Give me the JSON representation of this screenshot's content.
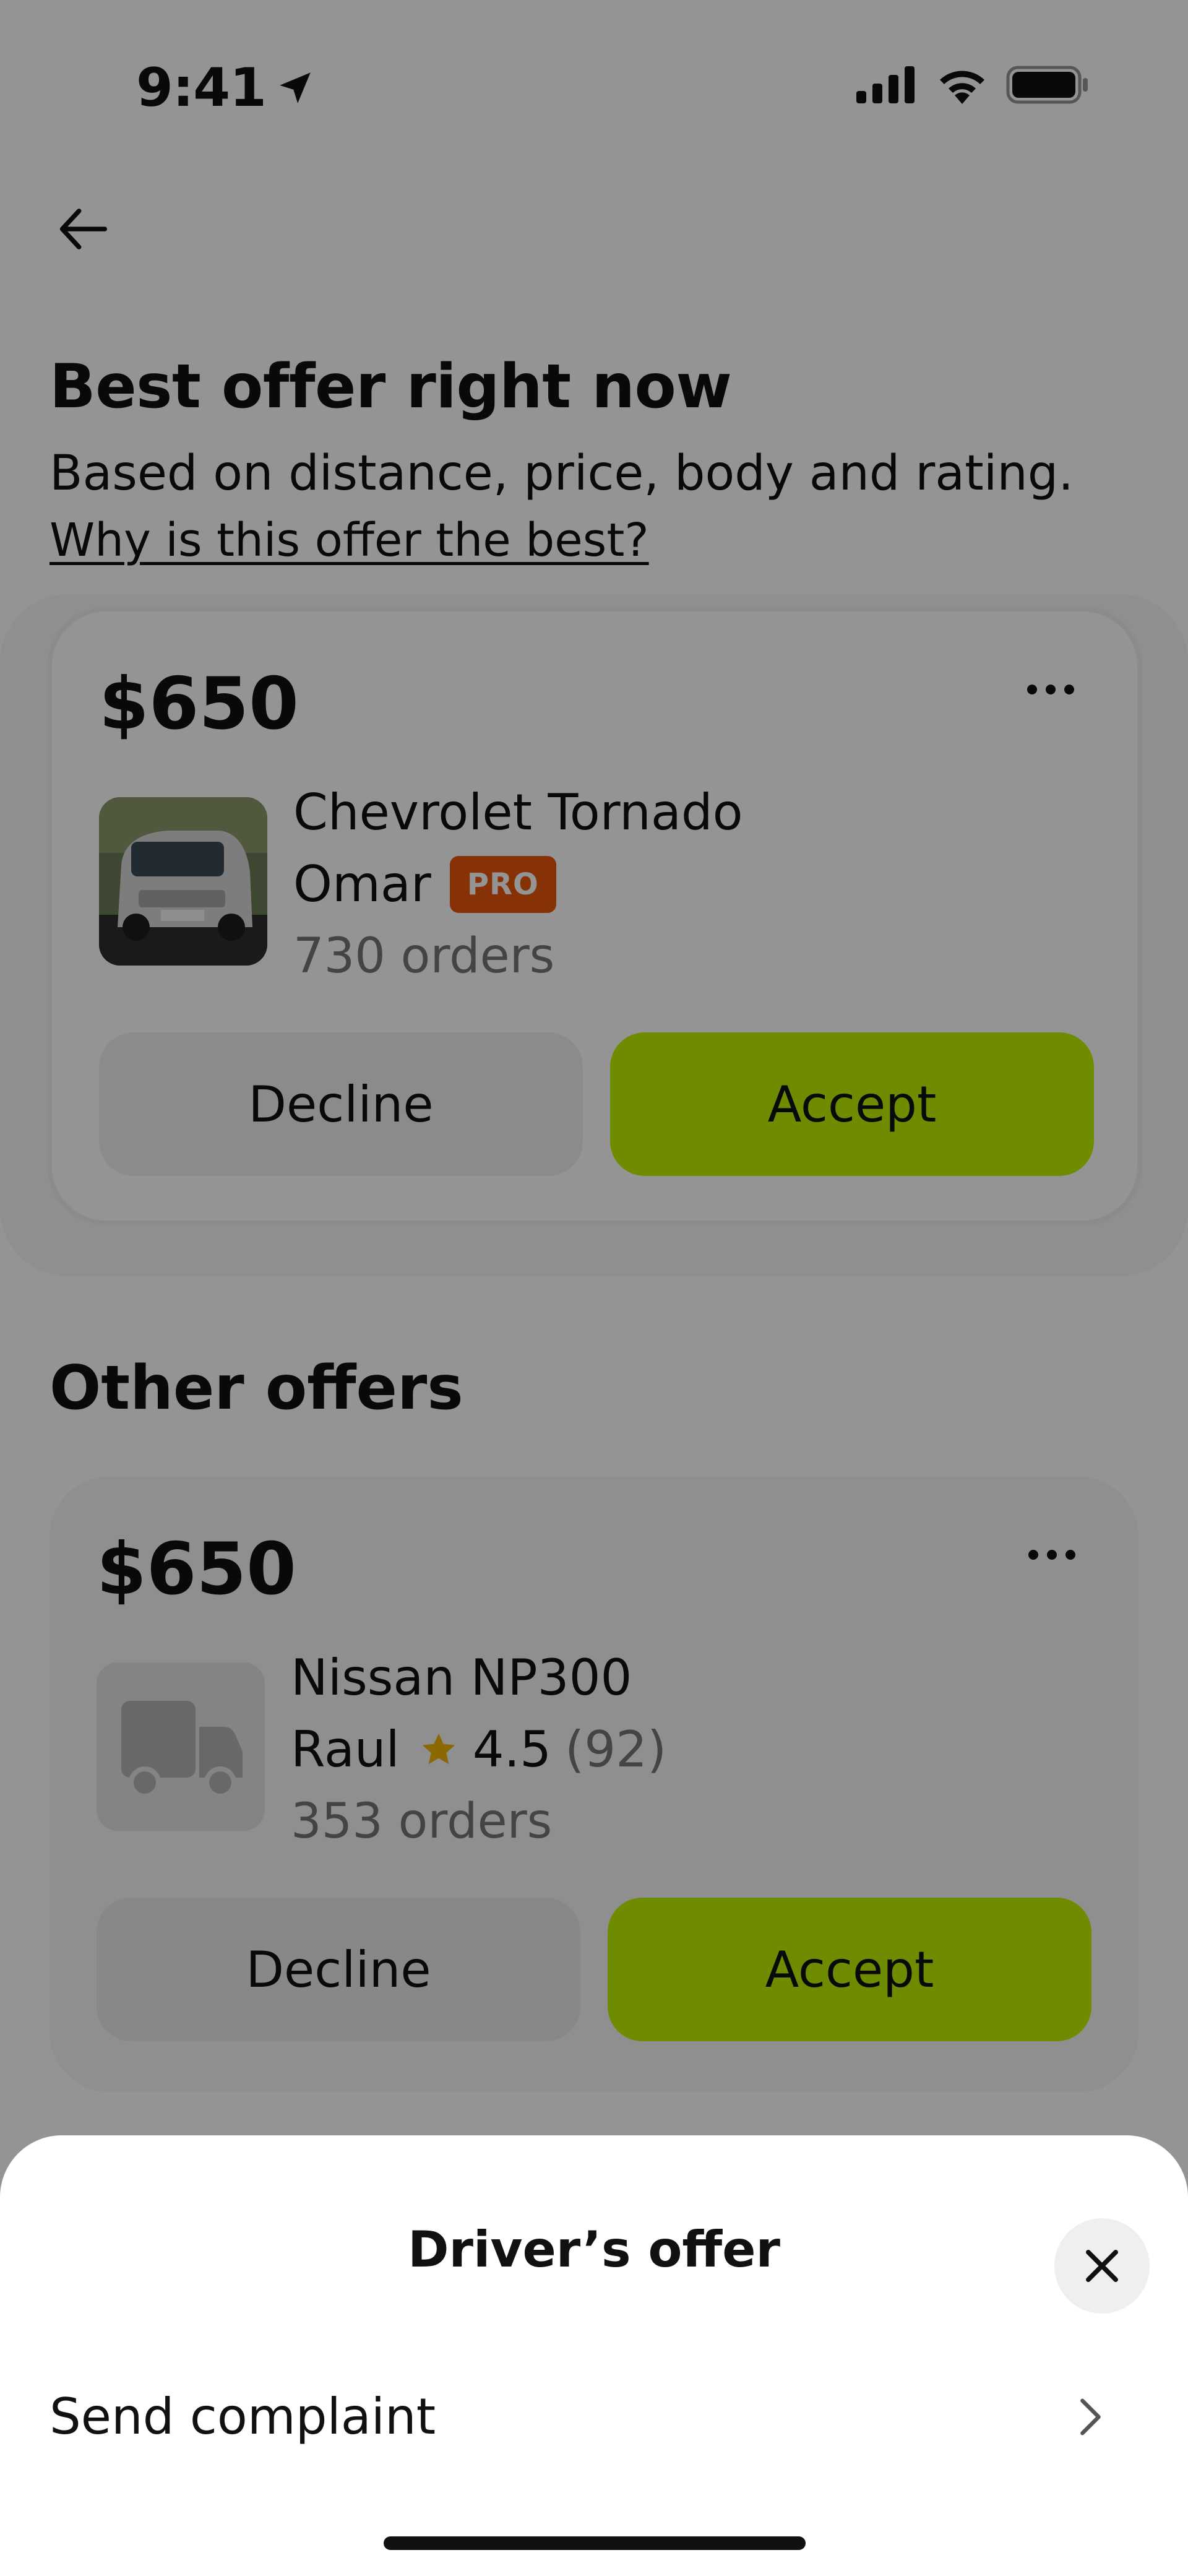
{
  "status_bar": {
    "time": "9:41"
  },
  "header": {
    "back_icon": "arrow-left-icon",
    "title": "Best offer right now",
    "subtitle": "Based on distance, price, body and rating.",
    "why_link": "Why is this offer the best?"
  },
  "best_offer": {
    "price": "$650",
    "vehicle": "Chevrolet Tornado",
    "driver": "Omar",
    "badge": "PRO",
    "orders": "730 orders",
    "decline_label": "Decline",
    "accept_label": "Accept"
  },
  "other_offers": {
    "title": "Other offers",
    "items": [
      {
        "price": "$650",
        "vehicle": "Nissan NP300",
        "driver": "Raul",
        "rating": "4.5",
        "rating_count": "(92)",
        "orders": "353 orders",
        "decline_label": "Decline",
        "accept_label": "Accept"
      }
    ]
  },
  "sheet": {
    "title": "Driver’s offer",
    "items": [
      {
        "label": "Send complaint"
      }
    ]
  },
  "colors": {
    "accent": "#c0f000",
    "badge": "#e9560c",
    "star": "#f0b400",
    "muted_text": "#767676"
  }
}
